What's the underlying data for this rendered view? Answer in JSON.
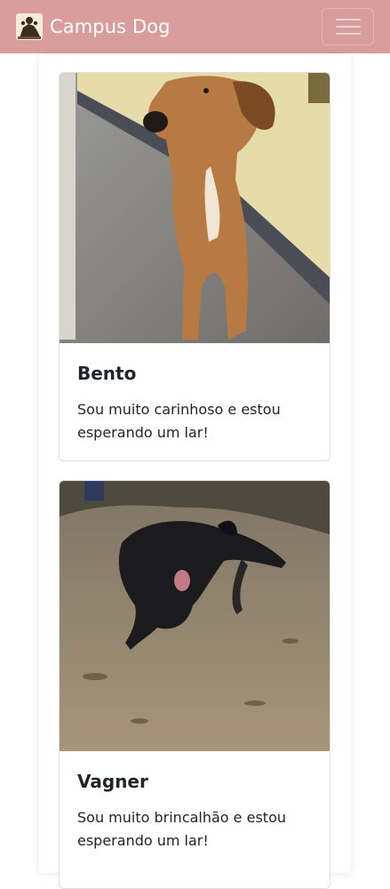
{
  "navbar": {
    "brand_name": "Campus Dog",
    "brand_logo_icon": "paw-logo-icon",
    "menu_icon": "hamburger-menu-icon",
    "background_color": "#d99d9d"
  },
  "dogs": [
    {
      "name": "Bento",
      "description": "Sou muito carinhoso e estou esperando um lar!"
    },
    {
      "name": "Vagner",
      "description": "Sou muito brincalhão e estou esperando um lar!"
    }
  ]
}
